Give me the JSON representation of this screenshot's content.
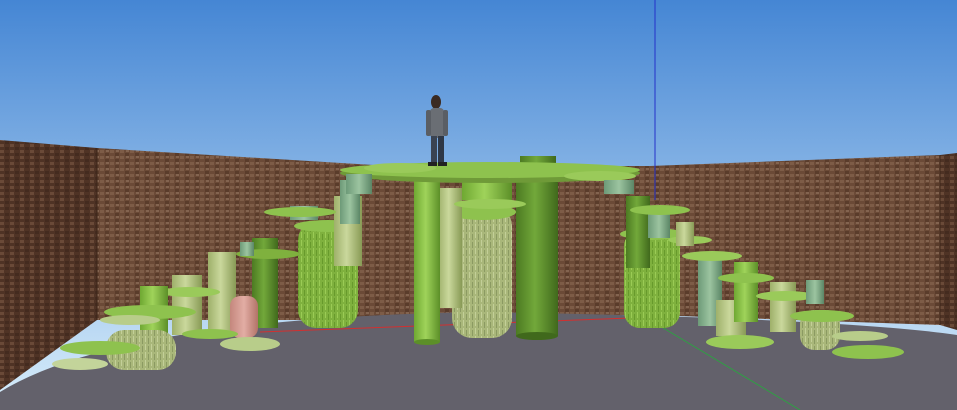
{
  "colors": {
    "sky_top": "#4a8ad6",
    "sky_bottom": "#d6ecfb",
    "brick_dark": "#5c3d2b",
    "brick_light": "#7a5a45",
    "floor": "#62606a",
    "axis_red": "#d23030",
    "axis_green": "#2ea043",
    "axis_blue": "#2431c9",
    "green_bright": "#8cc44a",
    "green_dark": "#5a8a2e",
    "green_pale": "#b8d08a",
    "pink": "#d8a098"
  }
}
